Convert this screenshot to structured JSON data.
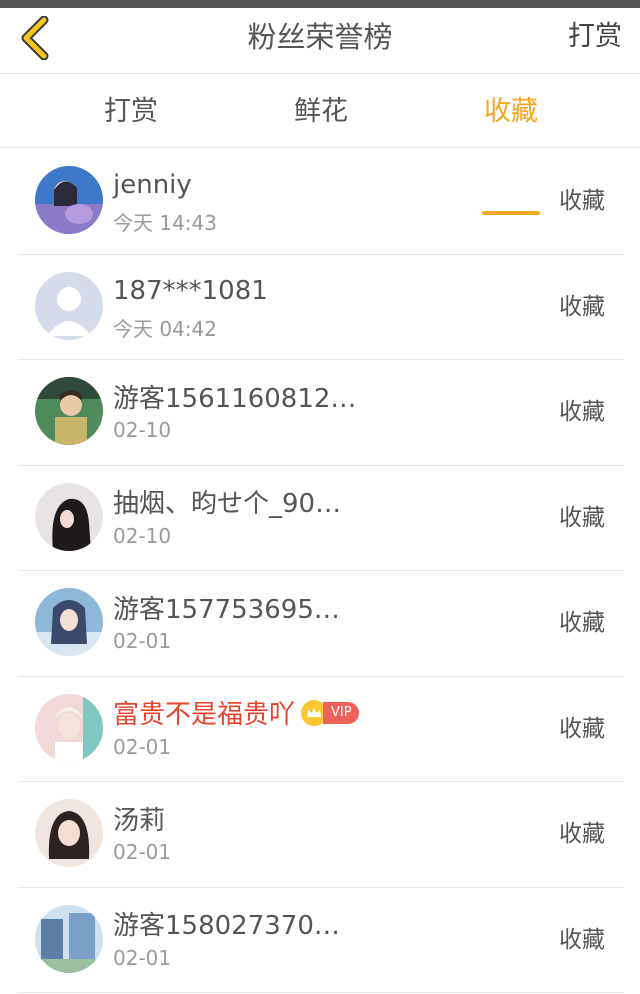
{
  "header": {
    "back_icon": "chevron-left-icon",
    "back_color": "#f5c518",
    "title": "粉丝荣誉榜",
    "action": "打赏"
  },
  "tabs": [
    {
      "label": "打赏",
      "active": false
    },
    {
      "label": "鲜花",
      "active": false
    },
    {
      "label": "收藏",
      "active": true
    }
  ],
  "accent_color": "#f5a623",
  "vip_name_color": "#e8432d",
  "fans": [
    {
      "name": "jenniy",
      "date": "今天 14:43",
      "action": "收藏",
      "vip": false
    },
    {
      "name": "187***1081",
      "date": "今天 04:42",
      "action": "收藏",
      "vip": false
    },
    {
      "name": "游客1561160812…",
      "date": "02-10",
      "action": "收藏",
      "vip": false
    },
    {
      "name": "抽烟、昀せ个_90…",
      "date": "02-10",
      "action": "收藏",
      "vip": false
    },
    {
      "name": "游客157753695…",
      "date": "02-01",
      "action": "收藏",
      "vip": false
    },
    {
      "name": "富贵不是福贵吖",
      "date": "02-01",
      "action": "收藏",
      "vip": true,
      "badge": "VIP"
    },
    {
      "name": "汤莉",
      "date": "02-01",
      "action": "收藏",
      "vip": false
    },
    {
      "name": "游客158027370…",
      "date": "02-01",
      "action": "收藏",
      "vip": false
    }
  ]
}
